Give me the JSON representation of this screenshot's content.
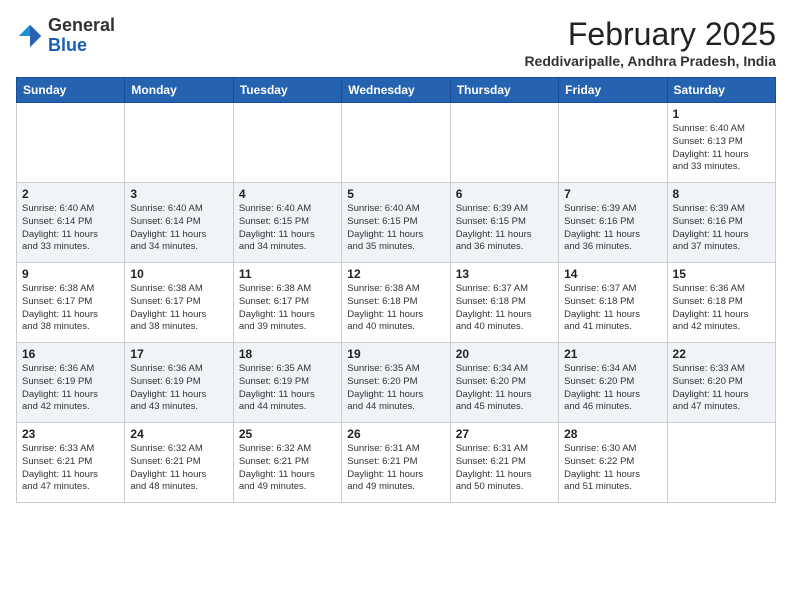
{
  "header": {
    "logo": {
      "general": "General",
      "blue": "Blue"
    },
    "month_year": "February 2025",
    "location": "Reddivaripalle, Andhra Pradesh, India"
  },
  "days_of_week": [
    "Sunday",
    "Monday",
    "Tuesday",
    "Wednesday",
    "Thursday",
    "Friday",
    "Saturday"
  ],
  "weeks": [
    [
      {
        "day": "",
        "info": ""
      },
      {
        "day": "",
        "info": ""
      },
      {
        "day": "",
        "info": ""
      },
      {
        "day": "",
        "info": ""
      },
      {
        "day": "",
        "info": ""
      },
      {
        "day": "",
        "info": ""
      },
      {
        "day": "1",
        "info": "Sunrise: 6:40 AM\nSunset: 6:13 PM\nDaylight: 11 hours\nand 33 minutes."
      }
    ],
    [
      {
        "day": "2",
        "info": "Sunrise: 6:40 AM\nSunset: 6:14 PM\nDaylight: 11 hours\nand 33 minutes."
      },
      {
        "day": "3",
        "info": "Sunrise: 6:40 AM\nSunset: 6:14 PM\nDaylight: 11 hours\nand 34 minutes."
      },
      {
        "day": "4",
        "info": "Sunrise: 6:40 AM\nSunset: 6:15 PM\nDaylight: 11 hours\nand 34 minutes."
      },
      {
        "day": "5",
        "info": "Sunrise: 6:40 AM\nSunset: 6:15 PM\nDaylight: 11 hours\nand 35 minutes."
      },
      {
        "day": "6",
        "info": "Sunrise: 6:39 AM\nSunset: 6:15 PM\nDaylight: 11 hours\nand 36 minutes."
      },
      {
        "day": "7",
        "info": "Sunrise: 6:39 AM\nSunset: 6:16 PM\nDaylight: 11 hours\nand 36 minutes."
      },
      {
        "day": "8",
        "info": "Sunrise: 6:39 AM\nSunset: 6:16 PM\nDaylight: 11 hours\nand 37 minutes."
      }
    ],
    [
      {
        "day": "9",
        "info": "Sunrise: 6:38 AM\nSunset: 6:17 PM\nDaylight: 11 hours\nand 38 minutes."
      },
      {
        "day": "10",
        "info": "Sunrise: 6:38 AM\nSunset: 6:17 PM\nDaylight: 11 hours\nand 38 minutes."
      },
      {
        "day": "11",
        "info": "Sunrise: 6:38 AM\nSunset: 6:17 PM\nDaylight: 11 hours\nand 39 minutes."
      },
      {
        "day": "12",
        "info": "Sunrise: 6:38 AM\nSunset: 6:18 PM\nDaylight: 11 hours\nand 40 minutes."
      },
      {
        "day": "13",
        "info": "Sunrise: 6:37 AM\nSunset: 6:18 PM\nDaylight: 11 hours\nand 40 minutes."
      },
      {
        "day": "14",
        "info": "Sunrise: 6:37 AM\nSunset: 6:18 PM\nDaylight: 11 hours\nand 41 minutes."
      },
      {
        "day": "15",
        "info": "Sunrise: 6:36 AM\nSunset: 6:18 PM\nDaylight: 11 hours\nand 42 minutes."
      }
    ],
    [
      {
        "day": "16",
        "info": "Sunrise: 6:36 AM\nSunset: 6:19 PM\nDaylight: 11 hours\nand 42 minutes."
      },
      {
        "day": "17",
        "info": "Sunrise: 6:36 AM\nSunset: 6:19 PM\nDaylight: 11 hours\nand 43 minutes."
      },
      {
        "day": "18",
        "info": "Sunrise: 6:35 AM\nSunset: 6:19 PM\nDaylight: 11 hours\nand 44 minutes."
      },
      {
        "day": "19",
        "info": "Sunrise: 6:35 AM\nSunset: 6:20 PM\nDaylight: 11 hours\nand 44 minutes."
      },
      {
        "day": "20",
        "info": "Sunrise: 6:34 AM\nSunset: 6:20 PM\nDaylight: 11 hours\nand 45 minutes."
      },
      {
        "day": "21",
        "info": "Sunrise: 6:34 AM\nSunset: 6:20 PM\nDaylight: 11 hours\nand 46 minutes."
      },
      {
        "day": "22",
        "info": "Sunrise: 6:33 AM\nSunset: 6:20 PM\nDaylight: 11 hours\nand 47 minutes."
      }
    ],
    [
      {
        "day": "23",
        "info": "Sunrise: 6:33 AM\nSunset: 6:21 PM\nDaylight: 11 hours\nand 47 minutes."
      },
      {
        "day": "24",
        "info": "Sunrise: 6:32 AM\nSunset: 6:21 PM\nDaylight: 11 hours\nand 48 minutes."
      },
      {
        "day": "25",
        "info": "Sunrise: 6:32 AM\nSunset: 6:21 PM\nDaylight: 11 hours\nand 49 minutes."
      },
      {
        "day": "26",
        "info": "Sunrise: 6:31 AM\nSunset: 6:21 PM\nDaylight: 11 hours\nand 49 minutes."
      },
      {
        "day": "27",
        "info": "Sunrise: 6:31 AM\nSunset: 6:21 PM\nDaylight: 11 hours\nand 50 minutes."
      },
      {
        "day": "28",
        "info": "Sunrise: 6:30 AM\nSunset: 6:22 PM\nDaylight: 11 hours\nand 51 minutes."
      },
      {
        "day": "",
        "info": ""
      }
    ]
  ]
}
